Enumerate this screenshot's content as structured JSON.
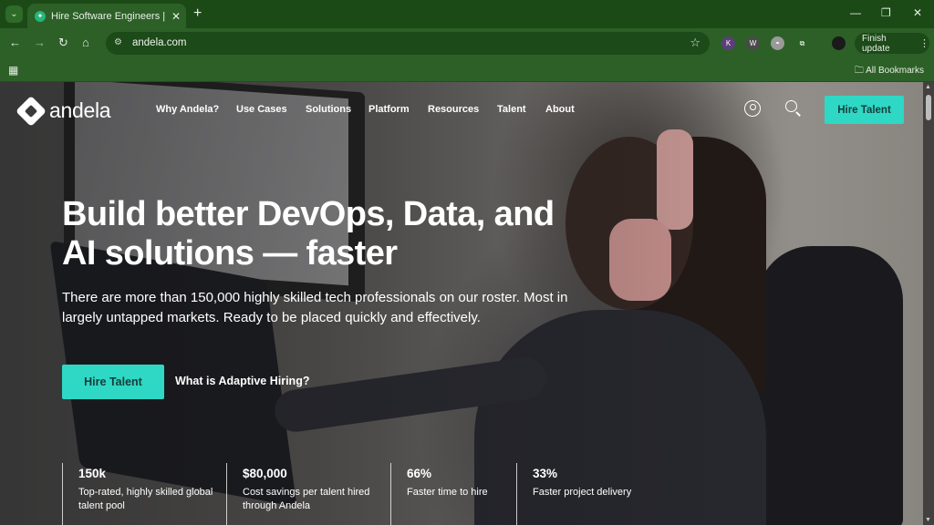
{
  "browser": {
    "tab": {
      "title": "Hire Software Engineers | On-D",
      "close": "✕"
    },
    "new_tab": "+",
    "window_controls": {
      "minimize": "—",
      "restore": "❐",
      "close": "✕"
    },
    "nav": {
      "back": "←",
      "forward": "→",
      "reload": "↻",
      "home": "⌂"
    },
    "omnibox": {
      "url": "andela.com",
      "site_info": "⚙",
      "star": "☆"
    },
    "extensions": [
      {
        "label": "K",
        "color": "#5b3f7a"
      },
      {
        "label": "W",
        "color": "#4a4a4a"
      },
      {
        "label": "◓",
        "color": "#9a9a9a"
      },
      {
        "label": "⧉",
        "color": "#2c6027"
      }
    ],
    "finish_update": {
      "label": "Finish update",
      "menu": "⋮"
    },
    "bookmarks": {
      "apps": "▦",
      "all_bookmarks": "All Bookmarks"
    }
  },
  "site": {
    "logo_text": "andela",
    "nav_items": [
      "Why Andela?",
      "Use Cases",
      "Solutions",
      "Platform",
      "Resources",
      "Talent",
      "About"
    ],
    "hire_button": "Hire Talent",
    "hero": {
      "headline": "Build better DevOps, Data, and AI solutions — faster",
      "subtext": "There are more than 150,000 highly skilled tech professionals on our roster. Most in largely untapped markets. Ready to be placed quickly and effectively.",
      "cta_primary": "Hire Talent",
      "cta_secondary": "What is Adaptive Hiring?"
    },
    "stats": [
      {
        "value": "150k",
        "desc": "Top-rated, highly skilled global talent pool"
      },
      {
        "value": "$80,000",
        "desc": "Cost savings per talent hired through Andela"
      },
      {
        "value": "66%",
        "desc": "Faster time to hire"
      },
      {
        "value": "33%",
        "desc": "Faster project delivery"
      }
    ],
    "accent_color": "#2ed8c5"
  }
}
